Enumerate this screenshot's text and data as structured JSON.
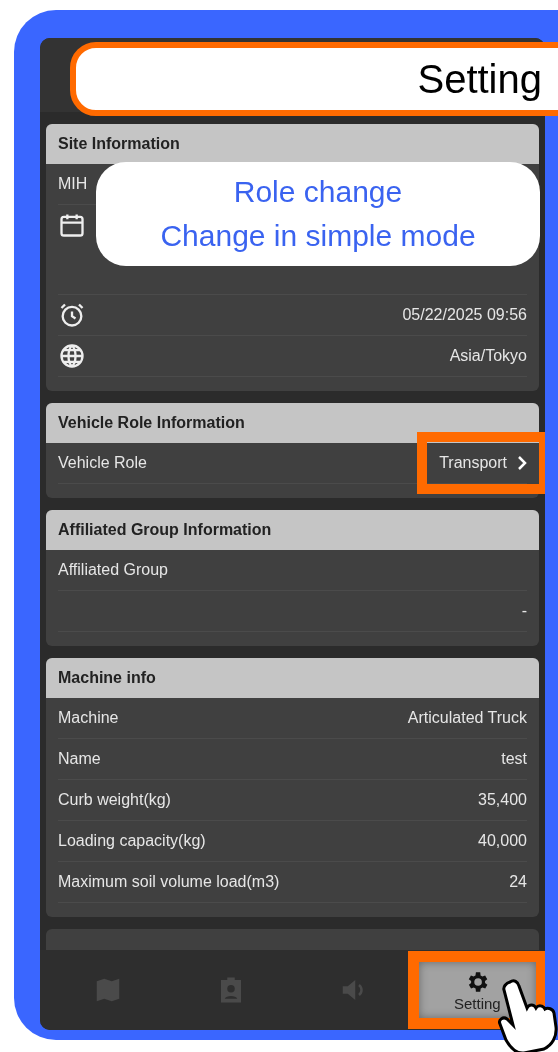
{
  "callouts": [
    {
      "kind": "title",
      "lines": [
        "Setting"
      ]
    },
    {
      "kind": "note",
      "lines": [
        "Role change",
        "Change in simple mode"
      ]
    }
  ],
  "sections": [
    {
      "title": "Site Information",
      "rows": [
        {
          "kind": "text",
          "label": "MIH"
        },
        {
          "kind": "icon"
        },
        {
          "kind": "icon",
          "value": "05/22/2025 09:56"
        },
        {
          "kind": "icon",
          "value": "Asia/Tokyo"
        }
      ]
    },
    {
      "title": "Vehicle Role Information",
      "rows": [
        {
          "kind": "link",
          "label": "Vehicle Role",
          "value": "Transport",
          "highlighted": true
        }
      ]
    },
    {
      "title": "Affiliated Group Information",
      "rows": [
        {
          "kind": "text",
          "label": "Affiliated Group"
        },
        {
          "kind": "text",
          "value": "-"
        }
      ]
    },
    {
      "title": "Machine info",
      "rows": [
        {
          "kind": "text",
          "label": "Machine",
          "value": "Articulated Truck"
        },
        {
          "kind": "text",
          "label": "Name",
          "value": "test"
        },
        {
          "kind": "text",
          "label": "Curb weight(kg)",
          "value": "35,400"
        },
        {
          "kind": "text",
          "label": "Loading capacity(kg)",
          "value": "40,000"
        },
        {
          "kind": "text",
          "label": "Maximum soil volume load(m3)",
          "value": "24"
        }
      ]
    }
  ],
  "tabs": [
    {
      "selected": false,
      "highlighted": false
    },
    {
      "selected": false,
      "highlighted": false
    },
    {
      "selected": false,
      "highlighted": false
    },
    {
      "label": "Setting",
      "selected": true,
      "highlighted": true
    }
  ]
}
